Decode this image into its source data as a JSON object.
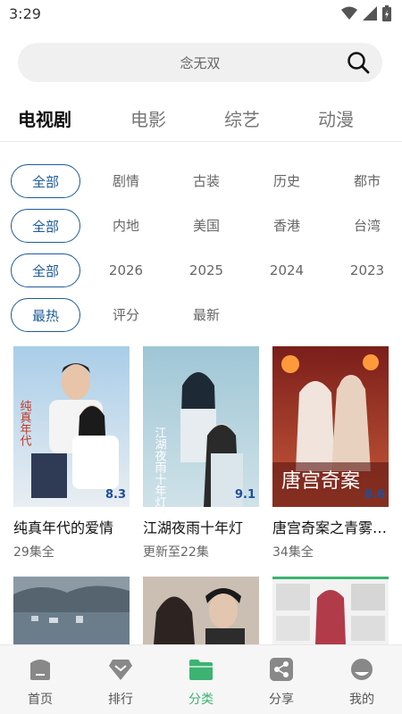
{
  "status": {
    "time": "3:29"
  },
  "search": {
    "placeholder": "念无双"
  },
  "tabs": [
    "电视剧",
    "电影",
    "综艺",
    "动漫"
  ],
  "filters": {
    "genre": [
      "全部",
      "剧情",
      "古装",
      "历史",
      "都市"
    ],
    "region": [
      "全部",
      "内地",
      "美国",
      "香港",
      "台湾"
    ],
    "year": [
      "全部",
      "2026",
      "2025",
      "2024",
      "2023"
    ],
    "sort": [
      "最热",
      "评分",
      "最新"
    ]
  },
  "cards": [
    {
      "title": "纯真年代的爱情",
      "sub": "29集全",
      "score": "8.3"
    },
    {
      "title": "江湖夜雨十年灯",
      "sub": "更新至22集",
      "score": "9.1"
    },
    {
      "title": "唐宫奇案之青雾…",
      "sub": "34集全",
      "score": "8.6"
    }
  ],
  "poster_text": {
    "p2": "江湖夜雨十年灯",
    "p3": "唐宫奇案"
  },
  "bottom_nav": [
    "首页",
    "排行",
    "分类",
    "分享",
    "我的"
  ],
  "colors": {
    "accent": "#1f5b97",
    "nav_active": "#3cb371"
  }
}
